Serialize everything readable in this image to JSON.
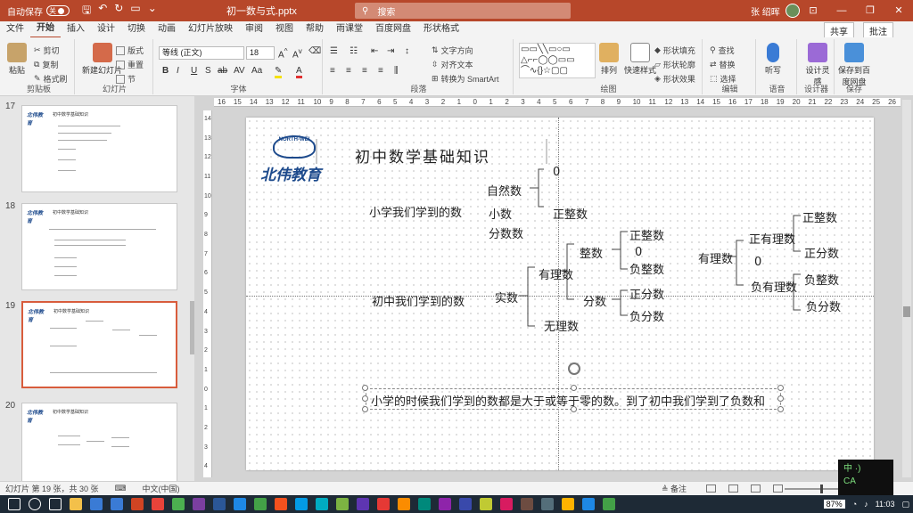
{
  "titlebar": {
    "autosave_label": "自动保存",
    "autosave_state": "关",
    "doc_title": "初一数与式.pptx",
    "search_placeholder": "搜索",
    "user_name": "张 绍晖",
    "win_minimize": "—",
    "win_maximize": "❐",
    "win_close": "✕",
    "win_ribbon_opt": "⊡"
  },
  "tabs": {
    "items": [
      "文件",
      "开始",
      "插入",
      "设计",
      "切换",
      "动画",
      "幻灯片放映",
      "审阅",
      "视图",
      "帮助",
      "雨课堂",
      "百度网盘",
      "形状格式"
    ],
    "active": "开始",
    "share": "共享",
    "comment": "批注"
  },
  "ribbon": {
    "clipboard": {
      "label": "剪贴板",
      "paste": "粘贴",
      "cut": "剪切",
      "copy": "复制",
      "format_painter": "格式刷"
    },
    "slides": {
      "label": "幻灯片",
      "new_slide": "新建幻灯片",
      "layout": "版式",
      "reset": "重置",
      "section": "节"
    },
    "font": {
      "label": "字体",
      "font_name": "等线 (正文)",
      "font_size": "18",
      "bold": "B",
      "italic": "I",
      "underline": "U",
      "shadow": "S",
      "strike": "ab",
      "spacing": "AV",
      "case": "Aa"
    },
    "paragraph": {
      "label": "段落",
      "text_direction": "文字方向",
      "align_text": "对齐文本",
      "smartart": "转换为 SmartArt"
    },
    "drawing": {
      "label": "绘图",
      "arrange": "排列",
      "quick_styles": "快速样式",
      "fill": "形状填充",
      "outline": "形状轮廓",
      "effects": "形状效果"
    },
    "editing": {
      "label": "编辑",
      "find": "查找",
      "replace": "替换",
      "select": "选择"
    },
    "voice": {
      "label": "语音",
      "dictate": "听写"
    },
    "designer": {
      "label": "设计器",
      "design_ideas": "设计灵感"
    },
    "save": {
      "label": "保存",
      "save_to_baidu": "保存到百度网盘"
    }
  },
  "thumbnails": [
    {
      "number": "17",
      "title": "初中数学基础知识",
      "logo": "北伟教育",
      "selected": false
    },
    {
      "number": "18",
      "title": "初中数学基础知识",
      "logo": "北伟教育",
      "selected": false
    },
    {
      "number": "19",
      "title": "初中数学基础知识",
      "logo": "北伟教育",
      "selected": true
    },
    {
      "number": "20",
      "title": "初中数学基础知识",
      "logo": "北伟教育",
      "selected": false
    }
  ],
  "hruler_ticks": [
    "16",
    "15",
    "14",
    "13",
    "12",
    "11",
    "10",
    "9",
    "8",
    "7",
    "6",
    "5",
    "4",
    "3",
    "2",
    "1",
    "0",
    "1",
    "2",
    "3",
    "4",
    "5",
    "6",
    "7",
    "8",
    "9",
    "10",
    "11",
    "12",
    "13",
    "14",
    "15",
    "16",
    "17",
    "18",
    "19",
    "20",
    "21",
    "22",
    "23",
    "24",
    "25",
    "26"
  ],
  "vruler_ticks": [
    "14",
    "13",
    "12",
    "11",
    "10",
    "9",
    "8",
    "7",
    "6",
    "5",
    "4",
    "3",
    "2",
    "1",
    "0",
    "1",
    "2",
    "3",
    "4"
  ],
  "slide": {
    "title": "初中数学基础知识",
    "logo_badge": "NORTH-WEI",
    "logo_text": "北伟教育",
    "primary_label": "小学我们学到的数",
    "primary_items": [
      "自然数",
      "小数",
      "分数数"
    ],
    "natural_sub": [
      "0",
      "正整数"
    ],
    "junior_label": "初中我们学到的数",
    "real": "实数",
    "rational": "有理数",
    "irrational": "无理数",
    "integer": "整数",
    "integer_sub": [
      "正整数",
      "0",
      "负整数"
    ],
    "fraction": "分数",
    "fraction_sub": [
      "正分数",
      "负分数"
    ],
    "rational2": "有理数",
    "zero2": "0",
    "pos_rational": "正有理数",
    "neg_rational": "负有理数",
    "pos_sub": [
      "正整数",
      "正分数"
    ],
    "neg_sub": [
      "负整数",
      "负分数"
    ],
    "textline": "小学的时候我们学到的数都是大于或等于零的数。到了初中我们学到了负数和"
  },
  "statusbar": {
    "slide_info": "幻灯片 第 19 张，共 30 张",
    "language": "中文(中国)",
    "notes": "备注",
    "zoom": "87%"
  },
  "ime": {
    "line1": "中 ·)",
    "line2": "CA"
  },
  "taskbar": {
    "time": "11:03",
    "icons": [
      "start",
      "search",
      "task-view",
      "explorer",
      "store",
      "mail",
      "powerpoint",
      "browser",
      "chrome",
      "onenote",
      "word",
      "app1",
      "app2",
      "app3",
      "app4",
      "app5",
      "app6",
      "app7",
      "app8",
      "app9",
      "app10",
      "app11",
      "app12",
      "app13",
      "app14",
      "app15",
      "app16",
      "app17",
      "app18",
      "app19"
    ],
    "icon_colors": [
      "#ffffff",
      "#ffffff",
      "#ffffff",
      "#f3c04a",
      "#3a7bd5",
      "#3a7bd5",
      "#d04423",
      "#e8433a",
      "#4caf50",
      "#7b3fa0",
      "#2b5797",
      "#1e88e5",
      "#43a047",
      "#f4511e",
      "#039be5",
      "#00acc1",
      "#7cb342",
      "#5e35b1",
      "#e53935",
      "#fb8c00",
      "#00897b",
      "#8e24aa",
      "#3949ab",
      "#c0ca33",
      "#d81b60",
      "#6d4c41",
      "#546e7a",
      "#ffb300",
      "#1e88e5",
      "#43a047"
    ]
  },
  "colors": {
    "accent": "#b7472a",
    "logo_blue": "#1d4a8c",
    "selection": "#d85c3c"
  }
}
